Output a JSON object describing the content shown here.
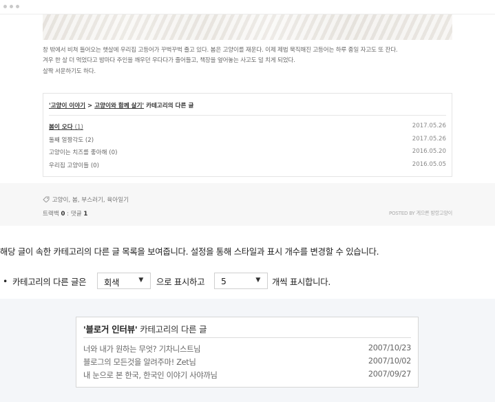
{
  "post": {
    "body_lines": [
      "창 밖에서 비쳐 들어오는 햇살에 우리집 고등어가 꾸벅꾸벅 졸고 있다. 봄은 고양이를 재운다. 이제 제법 묵직해진 고등어는 하루 종일 자고도 또 잔다.",
      "겨우 한 살 더 먹었다고 밤마다 주인을 깨우던 우다다가 줄어들고, 책장을 엎어놓는 사고도 덜 치게 되었다.",
      "살짝 서운하기도 하다."
    ],
    "related": {
      "title_cat1": "'고양이 이야기",
      "title_sep": " > ",
      "title_cat2": "고양이와 함께 살기'",
      "title_suffix": " 카테고리의 다른 글",
      "items": [
        {
          "title": "봄이 오다",
          "count": "(1)",
          "date": "2017.05.26"
        },
        {
          "title": "둘째 얼짱각도",
          "count": "(2)",
          "date": "2017.05.26"
        },
        {
          "title": "고양이는 치즈를 좋아해",
          "count": "(0)",
          "date": "2016.05.20"
        },
        {
          "title": "우리집 고양이들",
          "count": "(0)",
          "date": "2016.05.05"
        }
      ]
    },
    "tags": "고양이, 봄, 부스러기, 육아일기",
    "trackback_label": "트랙백",
    "trackback_count": "0",
    "sep": " : ",
    "comments_label": "댓글",
    "comments_count": "1",
    "posted_by": "POSTED BY 게으른 방랑고양이"
  },
  "settings": {
    "description": "해당 글이 속한 카테고리의 다른 글 목록을 보여줍니다. 설정을 통해 스타일과 표시 개수를 변경할 수 있습니다.",
    "bullet": "•",
    "label_before_style": "카테고리의 다른 글은",
    "style_value": "회색",
    "label_between": "으로 표시하고",
    "count_value": "5",
    "label_after_count": "개씩 표시합니다.",
    "dropdown_arrow": "▼"
  },
  "demo": {
    "title_bold": "'블로거 인터뷰'",
    "title_rest": " 카테고리의 다른 글",
    "items": [
      {
        "title": "너와 내가 원하는 무엇? 기차니스트님",
        "date": "2007/10/23"
      },
      {
        "title": "블로그의 모든것을 알려주마! Zet님",
        "date": "2007/10/02"
      },
      {
        "title": "내 눈으로 본 한국, 한국인 이야기 사야까님",
        "date": "2007/09/27"
      }
    ]
  },
  "icons": {
    "tag_icon": "tag-icon",
    "window_dots": "window-control-dots"
  },
  "colors": {
    "page_bg": "#ffffff",
    "preview_bg": "#f7f7f7",
    "demo_bg": "#f4f6f9",
    "text_dark": "#222222"
  }
}
